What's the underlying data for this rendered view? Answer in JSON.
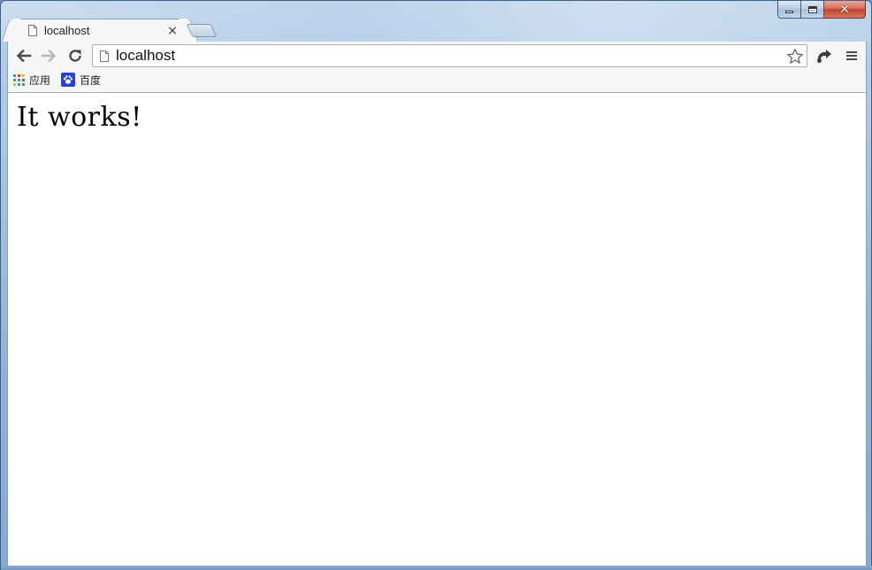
{
  "window": {
    "minimize_glyph": "",
    "close_glyph": "✕"
  },
  "tab": {
    "title": "localhost",
    "close_glyph": "×"
  },
  "omnibox": {
    "url": "localhost"
  },
  "bookmarks": {
    "items": [
      {
        "label": "应用",
        "icon": "apps-grid-icon"
      },
      {
        "label": "百度",
        "icon": "baidu-paw-icon"
      }
    ]
  },
  "page": {
    "heading": "It works!"
  },
  "colors": {
    "apps_grid": [
      "#4285f4",
      "#ea4335",
      "#fbbc05",
      "#34a853",
      "#4285f4",
      "#ea4335",
      "#fbbc05",
      "#34a853",
      "#4285f4"
    ],
    "baidu_blue": "#2a41d8"
  }
}
